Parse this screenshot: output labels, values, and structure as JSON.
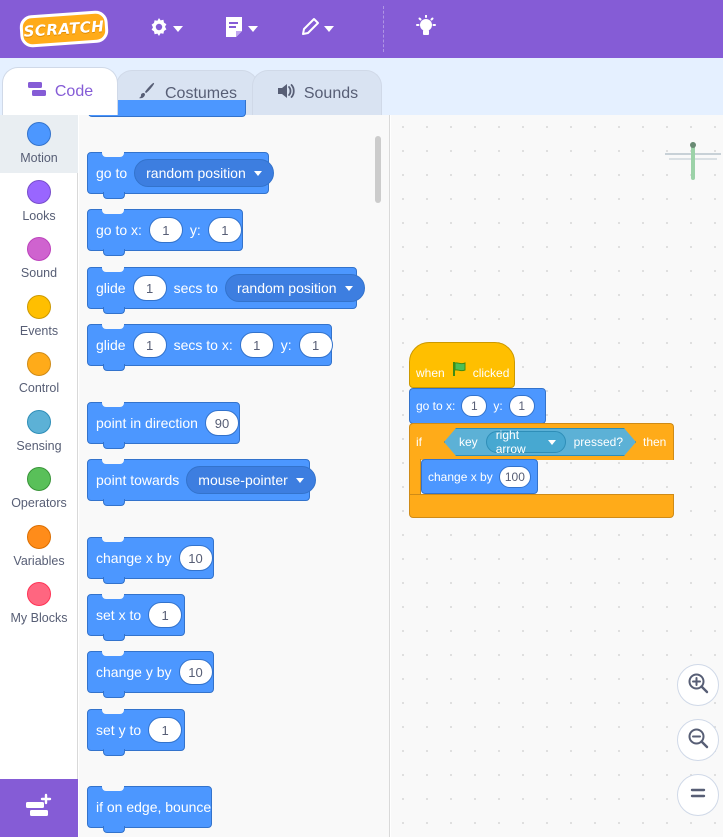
{
  "menu": {
    "logo_text": "SCRATCH",
    "icons": [
      "gear-icon",
      "file-icon",
      "edit-pencil-icon",
      "lightbulb-icon"
    ]
  },
  "tabs": [
    {
      "label": "Code",
      "icon": "code-blocks-icon",
      "active": true
    },
    {
      "label": "Costumes",
      "icon": "paintbrush-icon",
      "active": false
    },
    {
      "label": "Sounds",
      "icon": "speaker-icon",
      "active": false
    }
  ],
  "categories": [
    {
      "label": "Motion",
      "color": "#4c97ff",
      "selected": true
    },
    {
      "label": "Looks",
      "color": "#9966ff"
    },
    {
      "label": "Sound",
      "color": "#cf63cf"
    },
    {
      "label": "Events",
      "color": "#ffbf00"
    },
    {
      "label": "Control",
      "color": "#ffab19"
    },
    {
      "label": "Sensing",
      "color": "#5cb1d6"
    },
    {
      "label": "Operators",
      "color": "#59c059"
    },
    {
      "label": "Variables",
      "color": "#ff8c1a"
    },
    {
      "label": "My Blocks",
      "color": "#ff6680"
    }
  ],
  "palette": {
    "goto": {
      "label": "go to",
      "option": "random position"
    },
    "gotoxy": {
      "label": "go to x:",
      "x": "1",
      "ylabel": "y:",
      "y": "1"
    },
    "glide_random": {
      "label": "glide",
      "secs": "1",
      "mid": "secs to",
      "option": "random position"
    },
    "glide_xy": {
      "label": "glide",
      "secs": "1",
      "mid": "secs to x:",
      "x": "1",
      "ylabel": "y:",
      "y": "1"
    },
    "point_dir": {
      "label": "point in direction",
      "value": "90"
    },
    "point_towards": {
      "label": "point towards",
      "option": "mouse-pointer"
    },
    "change_x": {
      "label": "change x by",
      "value": "10"
    },
    "set_x": {
      "label": "set x to",
      "value": "1"
    },
    "change_y": {
      "label": "change y by",
      "value": "10"
    },
    "set_y": {
      "label": "set y to",
      "value": "1"
    },
    "bounce": {
      "label": "if on edge, bounce"
    }
  },
  "workspace": {
    "hat": {
      "when": "when",
      "clicked": "clicked",
      "flag_color": "#4cbf56"
    },
    "goto": {
      "label": "go to x:",
      "x": "1",
      "ylabel": "y:",
      "y": "1"
    },
    "if": {
      "label": "if",
      "then": "then"
    },
    "sensing": {
      "key": "key",
      "option": "right arrow",
      "pressed": "pressed?"
    },
    "change_x": {
      "label": "change x by",
      "value": "100"
    }
  },
  "zoom": {
    "in": "zoom-in-icon",
    "out": "zoom-out-icon",
    "reset": "zoom-reset-icon"
  }
}
